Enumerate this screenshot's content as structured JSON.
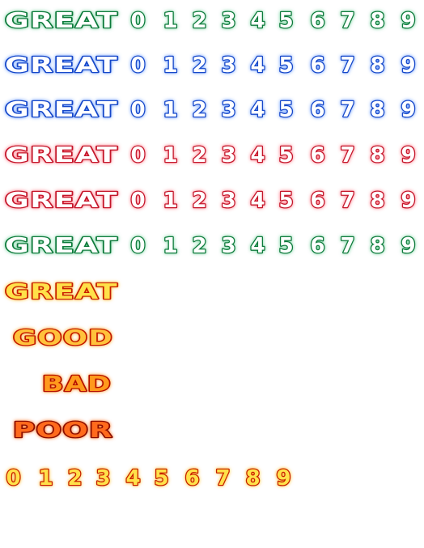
{
  "palettes": {
    "green": {
      "inner": "#ffffff",
      "stroke": "#0c7a3a",
      "glow": "#57c98a"
    },
    "blue": {
      "inner": "#ffffff",
      "stroke": "#1246c9",
      "glow": "#4f8cff"
    },
    "red": {
      "inner": "#ffffff",
      "stroke": "#c4122a",
      "glow": "#ff5a6a"
    },
    "yellow": {
      "inner": "#ffe14a",
      "stroke": "#c81e00",
      "glow": "#ffb200"
    },
    "orange": {
      "inner": "#ffc23a",
      "stroke": "#c41400",
      "glow": "#ff9a00"
    },
    "amber": {
      "inner": "#ff9a1a",
      "stroke": "#b40a00",
      "glow": "#ff8400"
    },
    "deep": {
      "inner": "#ff6a1a",
      "stroke": "#8a0a00",
      "glow": "#ff5c00"
    }
  },
  "rating_rows": [
    {
      "word": "GREAT",
      "palette": "green",
      "digits": [
        "0",
        "1",
        "2",
        "3",
        "4",
        "5",
        "6",
        "7",
        "8",
        "9"
      ]
    },
    {
      "word": "GREAT",
      "palette": "blue",
      "digits": [
        "0",
        "1",
        "2",
        "3",
        "4",
        "5",
        "6",
        "7",
        "8",
        "9"
      ]
    },
    {
      "word": "GREAT",
      "palette": "blue",
      "digits": [
        "0",
        "1",
        "2",
        "3",
        "4",
        "5",
        "6",
        "7",
        "8",
        "9"
      ]
    },
    {
      "word": "GREAT",
      "palette": "red",
      "digits": [
        "0",
        "1",
        "2",
        "3",
        "4",
        "5",
        "6",
        "7",
        "8",
        "9"
      ]
    },
    {
      "word": "GREAT",
      "palette": "red",
      "digits": [
        "0",
        "1",
        "2",
        "3",
        "4",
        "5",
        "6",
        "7",
        "8",
        "9"
      ]
    },
    {
      "word": "GREAT",
      "palette": "green",
      "digits": [
        "0",
        "1",
        "2",
        "3",
        "4",
        "5",
        "6",
        "7",
        "8",
        "9"
      ]
    }
  ],
  "judgement_words": [
    {
      "word": "GREAT",
      "palette": "yellow"
    },
    {
      "word": "GOOD",
      "palette": "orange"
    },
    {
      "word": "BAD",
      "palette": "amber"
    },
    {
      "word": "POOR",
      "palette": "deep"
    }
  ],
  "combo_digits": {
    "palette": "yellow",
    "digits": [
      "0",
      "1",
      "2",
      "3",
      "4",
      "5",
      "6",
      "7",
      "8",
      "9"
    ]
  }
}
